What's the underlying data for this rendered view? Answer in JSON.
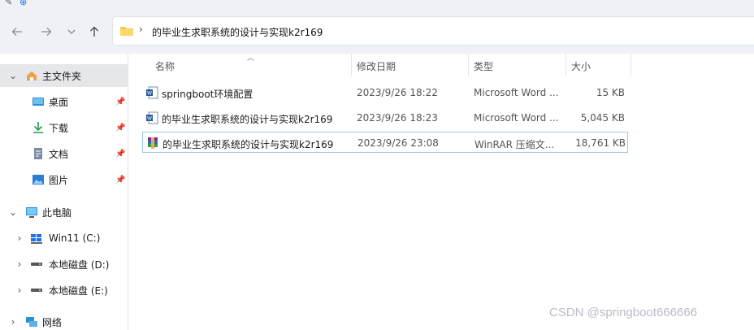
{
  "address_bar": {
    "path": "的毕业生求职系统的设计与实现k2r169",
    "separator": "›"
  },
  "sidebar": {
    "items": [
      {
        "label": "主文件夹",
        "icon": "home-icon",
        "pinned": false
      },
      {
        "label": "桌面",
        "icon": "desktop-icon",
        "pinned": true
      },
      {
        "label": "下载",
        "icon": "download-icon",
        "pinned": true
      },
      {
        "label": "文档",
        "icon": "document-icon",
        "pinned": true
      },
      {
        "label": "图片",
        "icon": "pictures-icon",
        "pinned": true
      },
      {
        "label": "此电脑",
        "icon": "computer-icon",
        "pinned": false
      },
      {
        "label": "Win11 (C:)",
        "icon": "windows-drive-icon",
        "pinned": false
      },
      {
        "label": "本地磁盘 (D:)",
        "icon": "drive-icon",
        "pinned": false
      },
      {
        "label": "本地磁盘 (E:)",
        "icon": "drive-icon",
        "pinned": false
      },
      {
        "label": "网络",
        "icon": "network-icon",
        "pinned": false
      }
    ]
  },
  "columns": {
    "name": "名称",
    "date": "修改日期",
    "type": "类型",
    "size": "大小"
  },
  "files": [
    {
      "name": "springboot环境配置",
      "date": "2023/9/26 18:22",
      "type": "Microsoft Word ...",
      "size": "15 KB",
      "icon": "word-doc-icon"
    },
    {
      "name": "的毕业生求职系统的设计与实现k2r169",
      "date": "2023/9/26 18:23",
      "type": "Microsoft Word ...",
      "size": "5,045 KB",
      "icon": "word-doc-icon"
    },
    {
      "name": "的毕业生求职系统的设计与实现k2r169",
      "date": "2023/9/26 23:08",
      "type": "WinRAR 压缩文...",
      "size": "18,761 KB",
      "icon": "winrar-archive-icon"
    }
  ],
  "watermark": "CSDN @springboot666666",
  "colors": {
    "toolbar_bg": "#eef2f7",
    "selected_border": "#99c9ef",
    "folder_yellow": "#f7c948",
    "accent_blue": "#1a73e8"
  }
}
